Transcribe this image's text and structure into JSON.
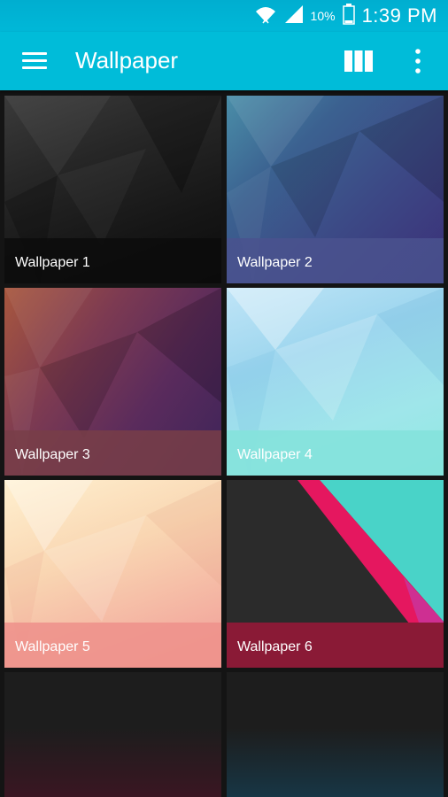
{
  "status_bar": {
    "battery_percent": "10%",
    "time": "1:39 PM",
    "icons": [
      "wifi-icon",
      "signal-icon",
      "battery-icon"
    ]
  },
  "app_bar": {
    "title": "Wallpaper",
    "icons": [
      "menu-icon",
      "grid-view-icon",
      "more-vert-icon"
    ],
    "color": "#00bcd9"
  },
  "wallpapers": [
    {
      "label": "Wallpaper 1"
    },
    {
      "label": "Wallpaper 2"
    },
    {
      "label": "Wallpaper 3"
    },
    {
      "label": "Wallpaper 4"
    },
    {
      "label": "Wallpaper 5"
    },
    {
      "label": "Wallpaper 6"
    }
  ]
}
